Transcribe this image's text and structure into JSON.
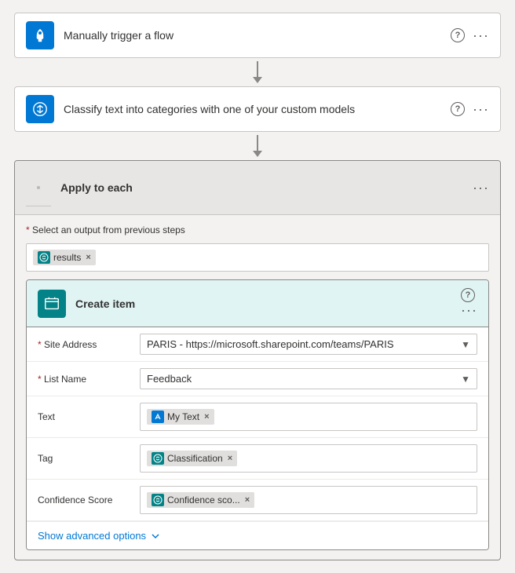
{
  "steps": [
    {
      "id": "trigger",
      "icon": "hand-icon",
      "iconColor": "blue",
      "title": "Manually trigger a flow"
    },
    {
      "id": "classify",
      "icon": "classify-icon",
      "iconColor": "blue",
      "title": "Classify text into categories with one of your custom models"
    }
  ],
  "applyEach": {
    "title": "Apply to each",
    "selectLabel": "Select an output from previous steps",
    "requiredMark": "*",
    "tags": [
      {
        "text": "results",
        "iconType": "teal"
      }
    ]
  },
  "createItem": {
    "title": "Create item",
    "fields": [
      {
        "label": "Site Address",
        "required": true,
        "type": "dropdown",
        "value": "PARIS - https://microsoft.sharepoint.com/teams/PARIS"
      },
      {
        "label": "List Name",
        "required": true,
        "type": "dropdown",
        "value": "Feedback"
      },
      {
        "label": "Text",
        "required": false,
        "type": "tags",
        "tags": [
          {
            "text": "My Text",
            "iconType": "blue",
            "closable": true
          }
        ]
      },
      {
        "label": "Tag",
        "required": false,
        "type": "tags",
        "tags": [
          {
            "text": "Classification",
            "iconType": "teal",
            "closable": true
          }
        ]
      },
      {
        "label": "Confidence Score",
        "required": false,
        "type": "tags",
        "tags": [
          {
            "text": "Confidence sco...",
            "iconType": "teal",
            "closable": true
          }
        ]
      }
    ],
    "showAdvanced": "Show advanced options"
  }
}
